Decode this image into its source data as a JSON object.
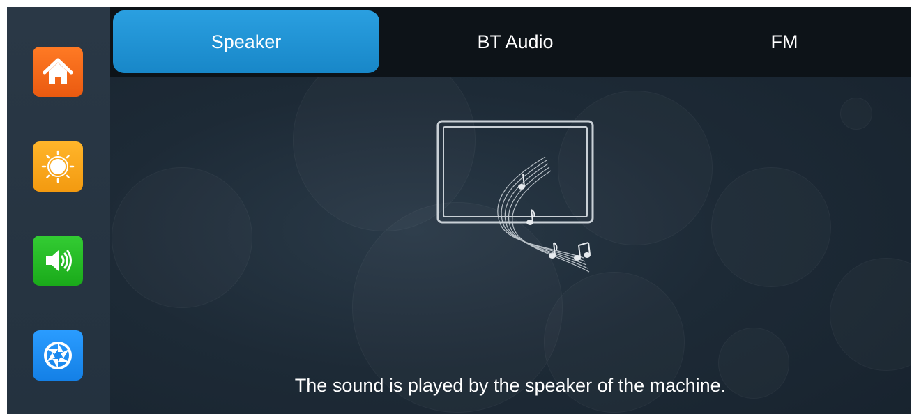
{
  "sidebar": {
    "items": [
      {
        "icon": "home-icon",
        "color": "#f26b1d"
      },
      {
        "icon": "brightness-icon",
        "color": "#f9a51a"
      },
      {
        "icon": "volume-icon",
        "color": "#22c022"
      },
      {
        "icon": "camera-shutter-icon",
        "color": "#1f8ef0"
      }
    ]
  },
  "tabs": [
    {
      "label": "Speaker",
      "active": true
    },
    {
      "label": "BT Audio",
      "active": false
    },
    {
      "label": "FM",
      "active": false
    }
  ],
  "main": {
    "illustration": "monitor-music-notes-icon",
    "caption": "The sound is played by the speaker of the machine."
  },
  "colors": {
    "active_tab": "#1f95d8",
    "tabbar_bg": "#0d1318",
    "screen_bg": "#1d2a36"
  }
}
